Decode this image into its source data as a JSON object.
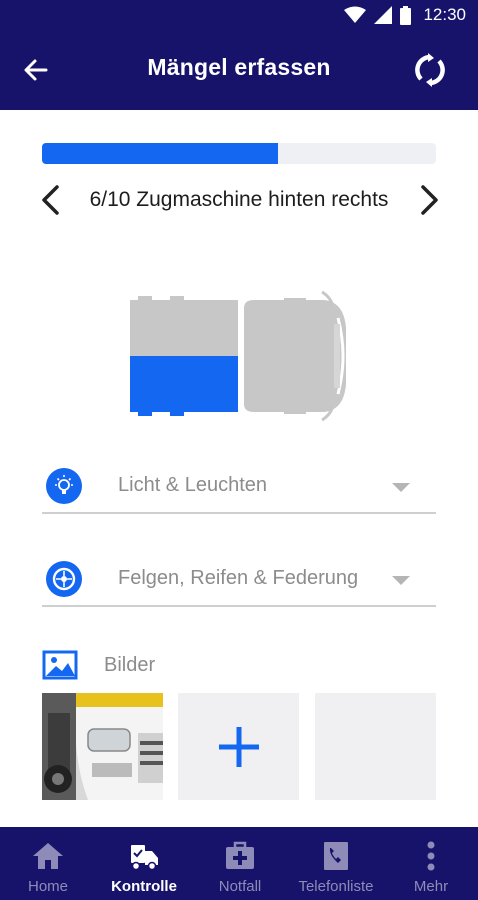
{
  "status_bar": {
    "time": "12:30"
  },
  "app_bar": {
    "title": "Mängel erfassen"
  },
  "progress": {
    "value": 0.6
  },
  "step": {
    "text": "6/10 Zugmaschine hinten rechts"
  },
  "categories": [
    {
      "label": "Licht & Leuchten",
      "icon": "lightbulb-icon"
    },
    {
      "label": "Felgen, Reifen & Federung",
      "icon": "wheel-icon"
    }
  ],
  "images": {
    "label": "Bilder",
    "icon": "image-icon"
  },
  "bottom_nav": [
    {
      "label": "Home",
      "icon": "home-icon",
      "active": false
    },
    {
      "label": "Kontrolle",
      "icon": "truck-check-icon",
      "active": true
    },
    {
      "label": "Notfall",
      "icon": "first-aid-icon",
      "active": false
    },
    {
      "label": "Telefonliste",
      "icon": "phone-book-icon",
      "active": false
    },
    {
      "label": "Mehr",
      "icon": "more-vertical-icon",
      "active": false
    }
  ],
  "colors": {
    "primary": "#17136b",
    "accent": "#1467f0"
  }
}
